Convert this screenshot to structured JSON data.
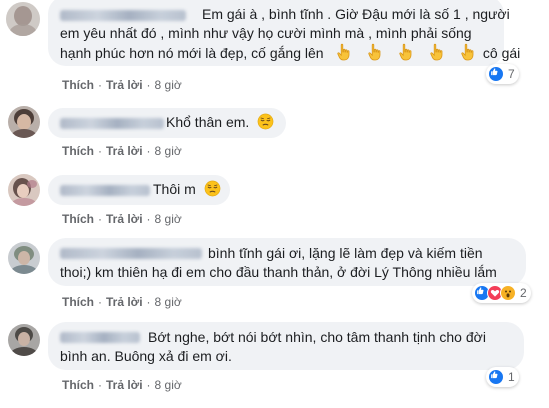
{
  "comments": [
    {
      "lines": [
        "Em gái à , bình tĩnh . Giờ Đậu mới là số 1 , người",
        "em yêu nhất đó , mình như vậy họ cười mình mà , mình phải sống",
        "hạnh phúc hơn nó mới là đẹp, cố gắng lên",
        "cô gái"
      ],
      "emojis": [
        "point-down-hand",
        "point-down-hand",
        "point-down-hand",
        "point-down-hand",
        "point-down-hand"
      ],
      "actions": {
        "like": "Thích",
        "reply": "Trả lời",
        "time": "8 giờ"
      },
      "reactions": {
        "types": [
          "like-icon"
        ],
        "count": "7"
      }
    },
    {
      "lines": [
        "Khổ thân em."
      ],
      "emojis": [
        "pensive-face"
      ],
      "actions": {
        "like": "Thích",
        "reply": "Trả lời",
        "time": "8 giờ"
      }
    },
    {
      "lines": [
        "Thôi m"
      ],
      "emojis": [
        "pensive-face"
      ],
      "actions": {
        "like": "Thích",
        "reply": "Trả lời",
        "time": "8 giờ"
      }
    },
    {
      "lines": [
        "bình tĩnh gái ơi, lặng lẽ làm đẹp và kiếm tiền",
        "thoi;) km thiên hạ đi em cho đầu thanh thản, ở đời Lý Thông nhiều lắm"
      ],
      "actions": {
        "like": "Thích",
        "reply": "Trả lời",
        "time": "8 giờ"
      },
      "reactions": {
        "types": [
          "like-icon",
          "love-icon",
          "wow-icon"
        ],
        "count": "2"
      }
    },
    {
      "lines": [
        "Bớt nghe, bớt nói bớt nhìn, cho tâm thanh tịnh cho đời",
        "bình an. Buông xả đi em ơi."
      ],
      "actions": {
        "like": "Thích",
        "reply": "Trả lời",
        "time": "8 giờ"
      },
      "reactions": {
        "types": [
          "like-icon"
        ],
        "count": "1"
      }
    }
  ],
  "colors": {
    "bubble_bg": "#f0f2f5",
    "text": "#1c1e21",
    "meta": "#65676b",
    "like_blue": "#1877f2",
    "love_red": "#f33e58",
    "wow_yellow": "#f7b125"
  }
}
